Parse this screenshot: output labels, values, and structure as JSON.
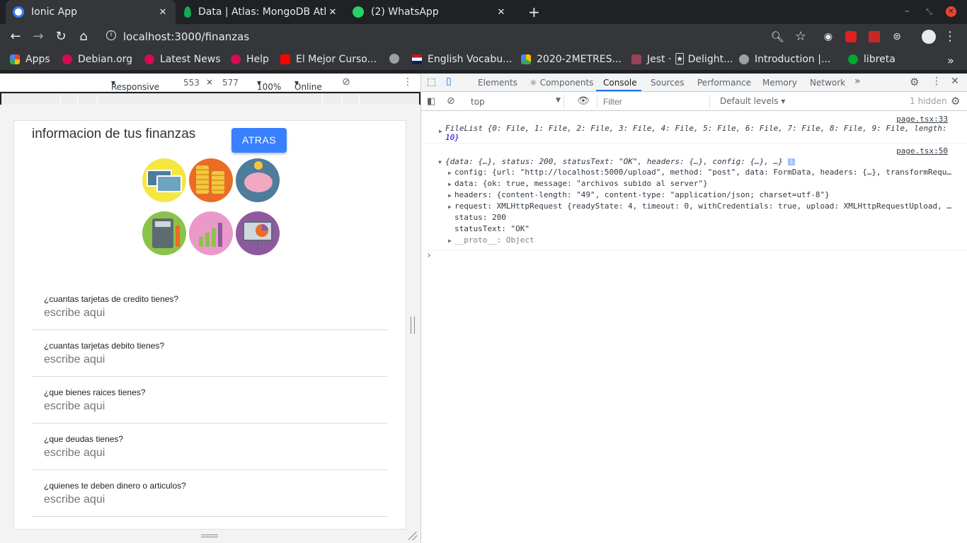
{
  "tabs": [
    {
      "title": "Ionic App",
      "active": true,
      "favicon_color": "#3880ff"
    },
    {
      "title": "Data | Atlas: MongoDB Atl",
      "active": false,
      "favicon_color": "#13aa52"
    },
    {
      "title": "(2) WhatsApp",
      "active": false,
      "favicon_color": "#25d366"
    }
  ],
  "toolbar": {
    "url": "localhost:3000/finanzas"
  },
  "bookmarks": [
    {
      "label": "Apps",
      "color": "#ea4335"
    },
    {
      "label": "Debian.org",
      "color": "#d70a53"
    },
    {
      "label": "Latest News",
      "color": "#d70a53"
    },
    {
      "label": "Help",
      "color": "#d70a53"
    },
    {
      "label": "El Mejor Curso...",
      "color": "#ff0000"
    },
    {
      "label": "English Vocabu...",
      "color": "#1f4e9e"
    },
    {
      "label": "2020-2METRES...",
      "color": "#fbbc04"
    },
    {
      "label": "Jest · 🃏 Delight...",
      "color": "#99425b"
    },
    {
      "label": "Introduction |...",
      "color": "#9aa0a6"
    },
    {
      "label": "libreta",
      "color": "#00a82d"
    }
  ],
  "device_toolbar": {
    "mode": "Responsive",
    "width": "553",
    "height": "577",
    "zoom": "100%",
    "throttle": "Online"
  },
  "app": {
    "title": "informacion de tus finanzas",
    "back_button": "ATRAS",
    "icons": [
      {
        "name": "credit-cards",
        "color": "#f5e642"
      },
      {
        "name": "coins",
        "color": "#ea6c25"
      },
      {
        "name": "piggy-bank",
        "color": "#4d7d9a"
      },
      {
        "name": "calculator",
        "color": "#8bc34a"
      },
      {
        "name": "growth-chart",
        "color": "#e99ac9"
      },
      {
        "name": "presentation",
        "color": "#8e5a9e"
      }
    ],
    "questions": [
      {
        "label": "¿cuantas tarjetas de credito tienes?",
        "placeholder": "escribe aqui"
      },
      {
        "label": "¿cuantas tarjetas debito tienes?",
        "placeholder": "escribe aqui"
      },
      {
        "label": "¿que bienes raices tienes?",
        "placeholder": "escribe aqui"
      },
      {
        "label": "¿que deudas tienes?",
        "placeholder": "escribe aqui"
      },
      {
        "label": "¿quienes te deben dinero o articulos?",
        "placeholder": "escribe aqui"
      }
    ]
  },
  "devtools": {
    "tabs": [
      "Elements",
      "Components",
      "Console",
      "Sources",
      "Performance",
      "Memory",
      "Network"
    ],
    "active_tab": "Console",
    "context": "top",
    "filter_placeholder": "Filter",
    "levels": "Default levels",
    "hidden": "1 hidden",
    "console": {
      "src1": "page.tsx:33",
      "line1a": "FileList {0: File, 1: File, 2: File, 3: File, 4: File, 5: File, 6: File, 7: File, 8: File, 9: File, length:",
      "line1b": "10}",
      "src2": "page.tsx:50",
      "line2": "{data: {…}, status: 200, statusText: \"OK\", headers: {…}, config: {…}, …}",
      "config": "config: {url: \"http://localhost:5000/upload\", method: \"post\", data: FormData, headers: {…}, transformRequ…",
      "data": "data: {ok: true, message: \"archivos subido al server\"}",
      "headers": "headers: {content-length: \"49\", content-type: \"application/json; charset=utf-8\"}",
      "request": "request: XMLHttpRequest {readyState: 4, timeout: 0, withCredentials: true, upload: XMLHttpRequestUpload, …",
      "status": "status: 200",
      "statusText": "statusText: \"OK\"",
      "proto": "__proto__: Object"
    }
  }
}
